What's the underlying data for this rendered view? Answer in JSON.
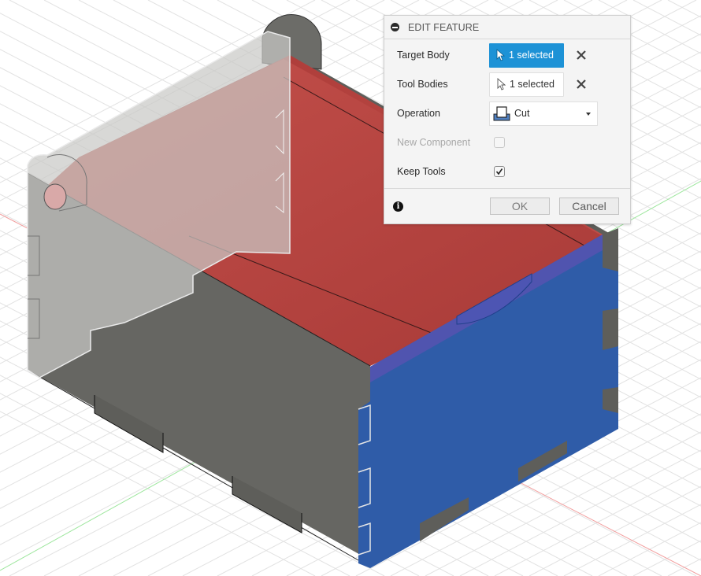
{
  "dialog": {
    "title": "EDIT FEATURE",
    "rows": {
      "target_body": {
        "label": "Target Body",
        "value": "1 selected",
        "state": "active"
      },
      "tool_bodies": {
        "label": "Tool Bodies",
        "value": "1 selected",
        "state": "idle"
      },
      "operation": {
        "label": "Operation",
        "value": "Cut",
        "icon": "cut-operation-icon"
      },
      "new_component": {
        "label": "New Component",
        "checked": false,
        "enabled": false
      },
      "keep_tools": {
        "label": "Keep Tools",
        "checked": true,
        "enabled": true
      }
    },
    "footer": {
      "info_glyph": "i",
      "ok_label": "OK",
      "cancel_label": "Cancel"
    }
  },
  "viewport": {
    "model": "finger-joint box",
    "colors": {
      "grid": "#e2e2e2",
      "x_axis": "#f08a8a",
      "y_axis": "#8ee08e",
      "body_gray": "#676763",
      "transparent_panel": "#b9b9b6",
      "target_body_red": "#b24340",
      "tool_body_blue": "#2f5ca8",
      "selection_accent": "#1d92d6"
    }
  }
}
